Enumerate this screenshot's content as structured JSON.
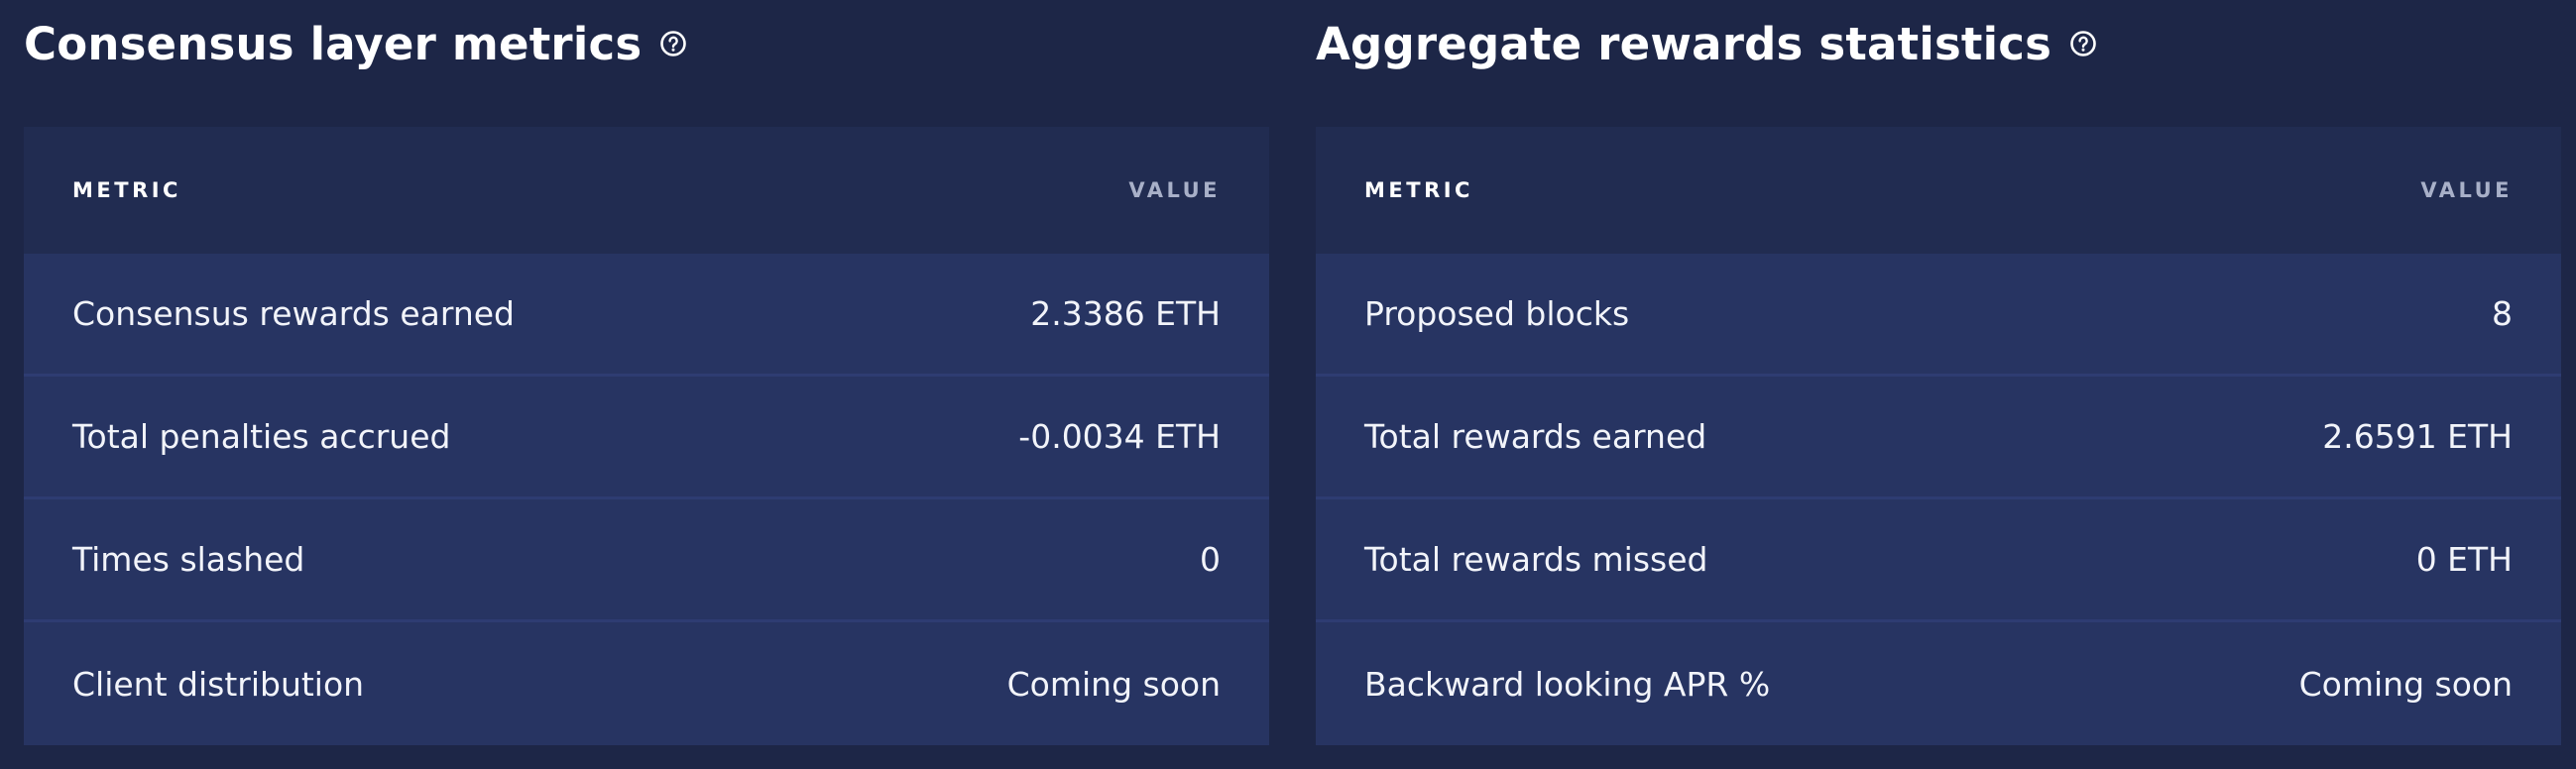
{
  "consensus": {
    "title": "Consensus layer metrics",
    "header": {
      "metric": "METRIC",
      "value": "VALUE"
    },
    "rows": [
      {
        "metric": "Consensus rewards earned",
        "value": "2.3386 ETH"
      },
      {
        "metric": "Total penalties accrued",
        "value": "-0.0034 ETH"
      },
      {
        "metric": "Times slashed",
        "value": "0"
      },
      {
        "metric": "Client distribution",
        "value": "Coming soon"
      }
    ]
  },
  "aggregate": {
    "title": "Aggregate rewards statistics",
    "header": {
      "metric": "METRIC",
      "value": "VALUE"
    },
    "rows": [
      {
        "metric": "Proposed blocks",
        "value": "8"
      },
      {
        "metric": "Total rewards earned",
        "value": "2.6591 ETH"
      },
      {
        "metric": "Total rewards missed",
        "value": "0 ETH"
      },
      {
        "metric": "Backward looking APR %",
        "value": "Coming soon"
      }
    ]
  },
  "icons": {
    "help": "help-circle-icon"
  },
  "colors": {
    "background": "#1d2647",
    "table_header": "#212c51",
    "table_row": "#273462",
    "row_divider": "#2e3c72",
    "text": "#ffffff",
    "muted_text": "#a8b0c8"
  }
}
